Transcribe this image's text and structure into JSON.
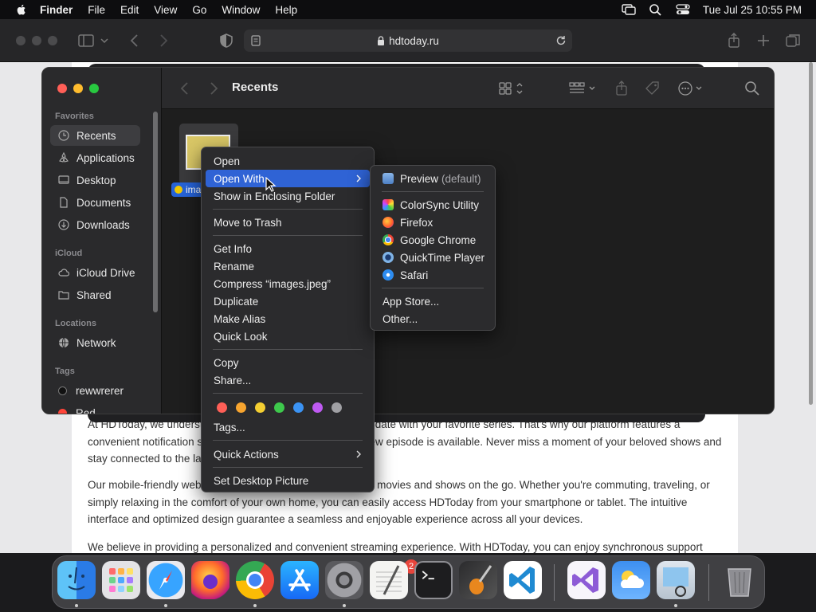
{
  "menubar": {
    "app_name": "Finder",
    "items": [
      "File",
      "Edit",
      "View",
      "Go",
      "Window",
      "Help"
    ],
    "clock": "Tue Jul 25  10:55 PM"
  },
  "safari": {
    "url": "hdtoday.ru"
  },
  "webpage": {
    "paragraphs": [
      "At HDToday, we understand the importance of staying up-to-date with your favorite series. That's why our platform features a convenient notification system that alerts you whenever a new episode is available. Never miss a moment of your beloved shows and stay connected to the latest releases.",
      "Our mobile-friendly website allows you to enjoy your favorite movies and shows on the go. Whether you're commuting, traveling, or simply relaxing in the comfort of your own home, you can easily access HDToday from your smartphone or tablet. The intuitive interface and optimized design guarantee a seamless and enjoyable experience across all your devices.",
      "We believe in providing a personalized and convenient streaming experience. With HDToday, you can enjoy synchronous support"
    ]
  },
  "finder": {
    "title": "Recents",
    "sidebar": {
      "favorites_label": "Favorites",
      "favorites": [
        "Recents",
        "Applications",
        "Desktop",
        "Documents",
        "Downloads"
      ],
      "icloud_label": "iCloud",
      "icloud": [
        "iCloud Drive",
        "Shared"
      ],
      "locations_label": "Locations",
      "locations": [
        "Network"
      ],
      "tags_label": "Tags",
      "tags": [
        {
          "name": "rewwrerer",
          "color": "#111111"
        },
        {
          "name": "Red",
          "color": "#ff453a"
        }
      ]
    },
    "file_label": "ima"
  },
  "context_menu": {
    "items": {
      "open": "Open",
      "open_with": "Open With",
      "show_in_folder": "Show in Enclosing Folder",
      "move_to_trash": "Move to Trash",
      "get_info": "Get Info",
      "rename": "Rename",
      "compress": "Compress “images.jpeg”",
      "duplicate": "Duplicate",
      "make_alias": "Make Alias",
      "quick_look": "Quick Look",
      "copy": "Copy",
      "share": "Share...",
      "tags": "Tags...",
      "quick_actions": "Quick Actions",
      "set_desktop_picture": "Set Desktop Picture"
    },
    "tag_colors": [
      "#ff5f57",
      "#f7a52f",
      "#f5cf32",
      "#3ec94c",
      "#3b93f3",
      "#bf5af2",
      "#a0a0a4"
    ]
  },
  "submenu": {
    "preview": "Preview",
    "preview_default": "(default)",
    "apps": [
      "ColorSync Utility",
      "Firefox",
      "Google Chrome",
      "QuickTime Player",
      "Safari"
    ],
    "app_store": "App Store...",
    "other": "Other..."
  },
  "dock": {
    "apps": [
      "Finder",
      "Launchpad",
      "Safari",
      "Firefox",
      "Google Chrome",
      "App Store",
      "System Settings",
      "TextEdit",
      "Terminal",
      "GarageBand",
      "Visual Studio Code",
      "Visual Studio",
      "Weather",
      "Preview",
      "Trash"
    ],
    "settings_badge": "2"
  }
}
